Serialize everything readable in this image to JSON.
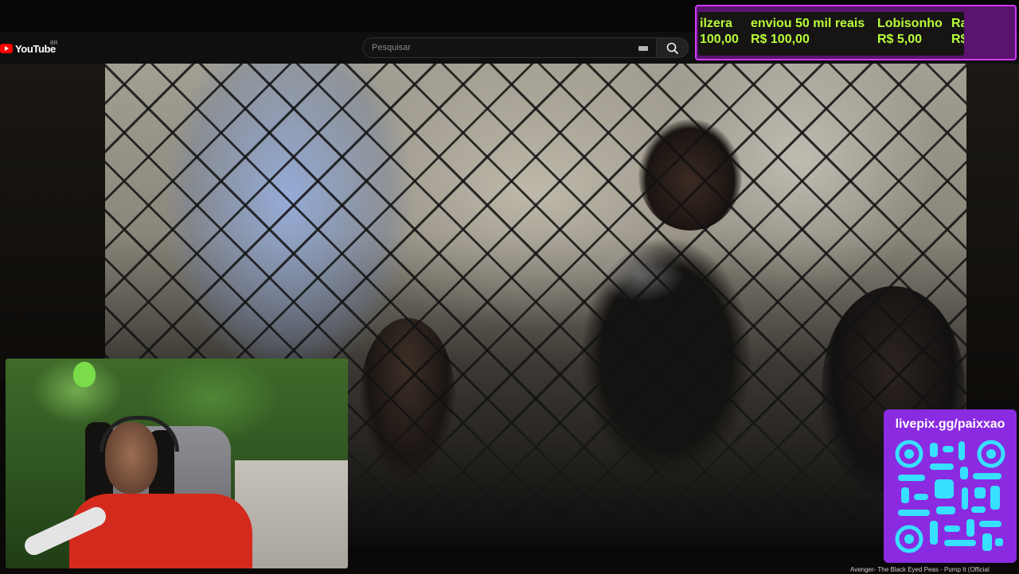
{
  "youtube": {
    "logo_text": "YouTube",
    "country": "BR",
    "search_placeholder": "Pesquisar"
  },
  "video": {
    "title_snippet": "Avenger- The Black Eyed Peas - Pump It (Official"
  },
  "donations": {
    "items": [
      {
        "name": "ilzera",
        "amount": "100,00"
      },
      {
        "name": "enviou 50 mil reais",
        "amount": "R$ 100,00"
      },
      {
        "name": "Lobisonho",
        "amount": "R$ 5,00"
      },
      {
        "name": "Ra",
        "amount": "R$"
      }
    ]
  },
  "pix": {
    "url": "livepix.gg/paixxao"
  },
  "colors": {
    "donation_text": "#b9ff3a",
    "donation_border": "#d23bff",
    "pix_bg": "#8a2be2",
    "youtube_red": "#ff0000"
  }
}
